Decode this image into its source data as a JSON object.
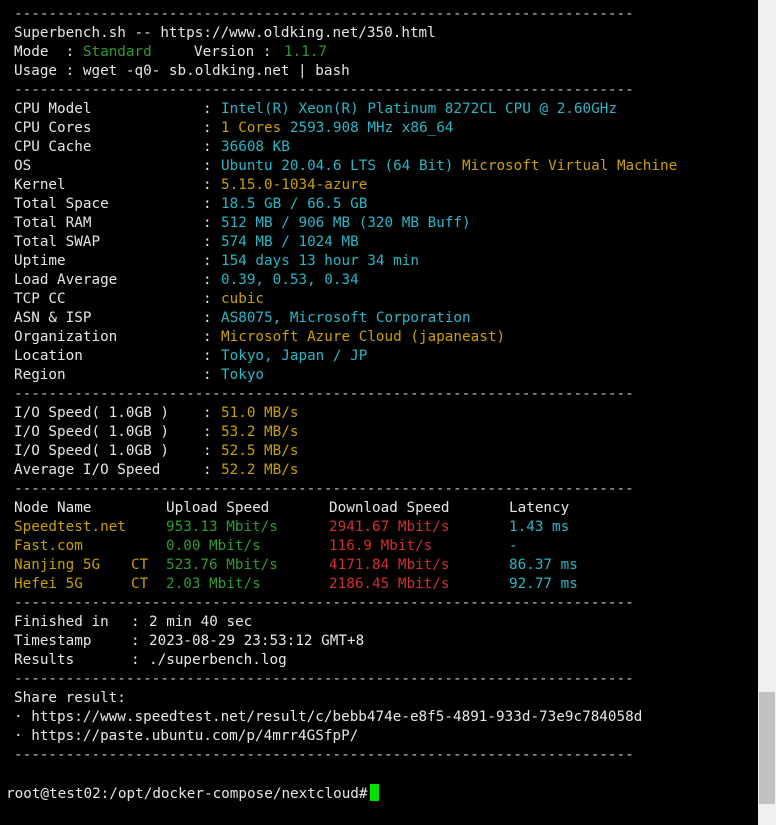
{
  "separator": "------------------------------------------------------------------------",
  "header": {
    "title": "Superbench.sh -- https://www.oldking.net/350.html",
    "mode_label": "Mode  : ",
    "mode_value": "Standard",
    "version_label": "Version : ",
    "version_value": "1.1.7",
    "usage": "Usage : wget -q0- sb.oldking.net | bash"
  },
  "sysinfo": [
    {
      "label": "CPU Model",
      "value": "Intel(R) Xeon(R) Platinum 8272CL CPU @ 2.60GHz",
      "extra": ""
    },
    {
      "label": "CPU Cores",
      "value": "1 Cores ",
      "value2": "2593.908 MHz x86_64"
    },
    {
      "label": "CPU Cache",
      "value": "36608 KB",
      "extra": ""
    },
    {
      "label": "OS",
      "value": "Ubuntu 20.04.6 LTS (64 Bit) ",
      "extra": "Microsoft Virtual Machine"
    },
    {
      "label": "Kernel",
      "value": "5.15.0-1034-azure",
      "extra": ""
    },
    {
      "label": "Total Space",
      "value": "18.5 GB / 66.5 GB",
      "extra": ""
    },
    {
      "label": "Total RAM",
      "value": "512 MB / 906 MB (320 MB Buff)",
      "extra": ""
    },
    {
      "label": "Total SWAP",
      "value": "574 MB / 1024 MB",
      "extra": ""
    },
    {
      "label": "Uptime",
      "value": "154 days 13 hour 34 min",
      "extra": ""
    },
    {
      "label": "Load Average",
      "value": "0.39, 0.53, 0.34",
      "extra": ""
    },
    {
      "label": "TCP CC",
      "value": "cubic",
      "extra": ""
    },
    {
      "label": "ASN & ISP",
      "value": "AS8075, Microsoft Corporation",
      "extra": ""
    },
    {
      "label": "Organization",
      "value": "Microsoft Azure Cloud (japaneast)",
      "extra": ""
    },
    {
      "label": "Location",
      "value": "Tokyo, Japan / JP",
      "extra": ""
    },
    {
      "label": "Region",
      "value": "Tokyo",
      "extra": ""
    }
  ],
  "io": [
    {
      "label": "I/O Speed( 1.0GB )",
      "value": "51.0 MB/s"
    },
    {
      "label": "I/O Speed( 1.0GB )",
      "value": "53.2 MB/s"
    },
    {
      "label": "I/O Speed( 1.0GB )",
      "value": "52.5 MB/s"
    },
    {
      "label": "Average I/O Speed",
      "value": "52.2 MB/s"
    }
  ],
  "speed": {
    "headers": [
      "Node Name",
      "Upload Speed",
      "Download Speed",
      "Latency"
    ],
    "rows": [
      {
        "node": "Speedtest.net",
        "tag": "",
        "upload": "953.13 Mbit/s",
        "download": "2941.67 Mbit/s",
        "latency": "1.43 ms"
      },
      {
        "node": "Fast.com",
        "tag": "",
        "upload": "0.00 Mbit/s",
        "download": "116.9 Mbit/s",
        "latency": "-"
      },
      {
        "node": "Nanjing 5G",
        "tag": "CT",
        "upload": "523.76 Mbit/s",
        "download": "4171.84 Mbit/s",
        "latency": "86.37 ms"
      },
      {
        "node": "Hefei 5G",
        "tag": "CT",
        "upload": "2.03 Mbit/s",
        "download": "2186.45 Mbit/s",
        "latency": "92.77 ms"
      }
    ]
  },
  "summary": [
    {
      "label": "Finished in",
      "value": "2 min 40 sec"
    },
    {
      "label": "Timestamp",
      "value": "2023-08-29 23:53:12 GMT+8"
    },
    {
      "label": "Results",
      "value": "./superbench.log"
    }
  ],
  "share": {
    "title": "Share result:",
    "links": [
      "· https://www.speedtest.net/result/c/bebb474e-e8f5-4891-933d-73e9c784058d",
      "· https://paste.ubuntu.com/p/4mrr4GSfpP/"
    ]
  },
  "prompt": "root@test02:/opt/docker-compose/nextcloud#",
  "colors": {
    "background": "#000000",
    "text": "#e6e6e6",
    "green": "#2f9b2f",
    "yellow": "#c8a000",
    "cyan": "#29b6c6",
    "red": "#d22f2f",
    "cursor": "#00e000"
  }
}
